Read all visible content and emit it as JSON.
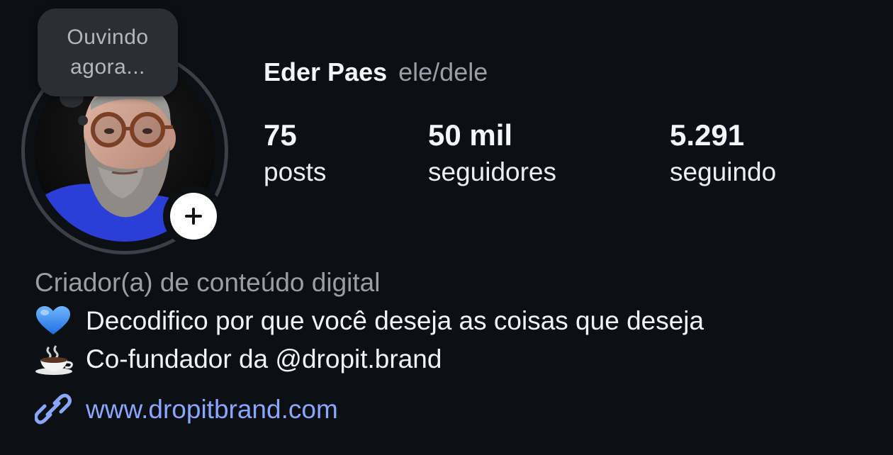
{
  "note": {
    "text_line1": "Ouvindo",
    "text_line2": "agora..."
  },
  "profile": {
    "name": "Eder Paes",
    "pronouns": "ele/dele"
  },
  "stats": [
    {
      "value": "75",
      "label": "posts"
    },
    {
      "value": "50 mil",
      "label": "seguidores"
    },
    {
      "value": "5.291",
      "label": "seguindo"
    }
  ],
  "bio": {
    "category": "Criador(a) de conteúdo digital",
    "line1": "Decodifico por que você deseja as coisas que deseja",
    "line1_icon": "blue-heart-icon",
    "line2": "Co-fundador da @dropit.brand",
    "line2_icon": "coffee-cup-icon"
  },
  "link": {
    "icon": "link-icon",
    "text": "www.dropitbrand.com"
  },
  "colors": {
    "background": "#0c0f14",
    "link": "#8aa7ff",
    "muted": "#9a9ea6",
    "note_bubble": "#2c2e33",
    "ring": "#3b3f47"
  }
}
